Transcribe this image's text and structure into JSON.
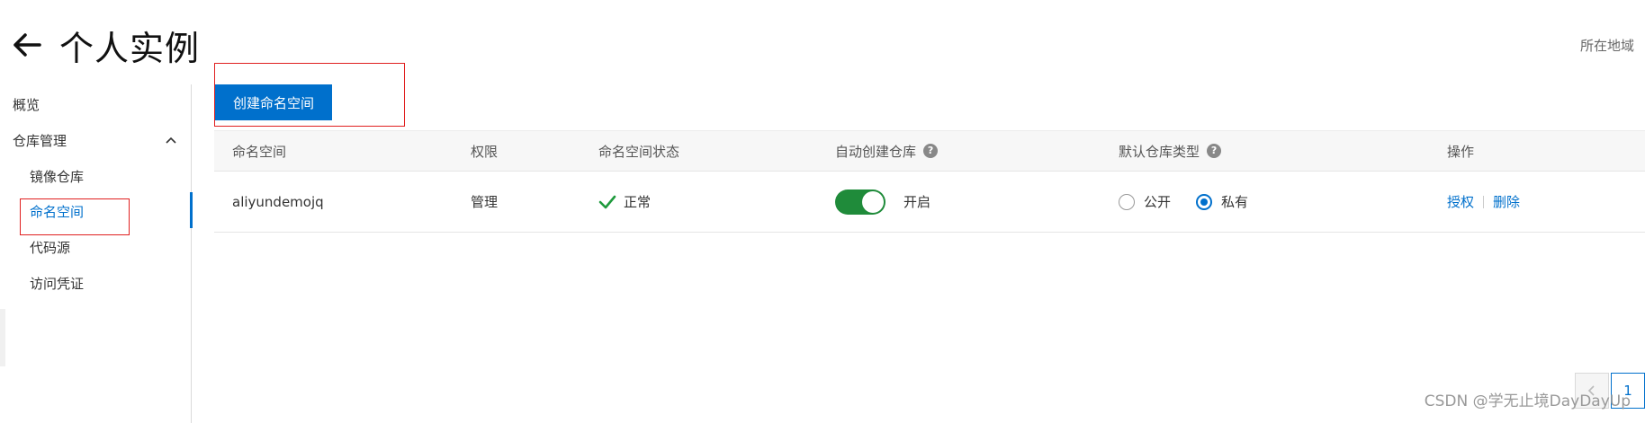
{
  "header": {
    "title": "个人实例",
    "region_label": "所在地域"
  },
  "sidebar": {
    "items": [
      {
        "label": "概览"
      },
      {
        "label": "仓库管理"
      },
      {
        "label": "镜像仓库"
      },
      {
        "label": "命名空间"
      },
      {
        "label": "代码源"
      },
      {
        "label": "访问凭证"
      }
    ],
    "active_item": "命名空间"
  },
  "toolbar": {
    "create_label": "创建命名空间"
  },
  "table": {
    "columns": [
      "命名空间",
      "权限",
      "命名空间状态",
      "自动创建仓库",
      "默认仓库类型",
      "操作"
    ],
    "rows": [
      {
        "namespace": "aliyundemojq",
        "permission": "管理",
        "status": "正常",
        "auto_create": "开启",
        "auto_create_enabled": true,
        "repo_type_options": [
          "公开",
          "私有"
        ],
        "repo_type_selected": "私有",
        "actions": [
          "授权",
          "删除"
        ]
      }
    ]
  },
  "pagination": {
    "current_page": "1"
  },
  "watermark": "CSDN @学无止境DayDayUp",
  "colors": {
    "accent": "#0070cc",
    "toggle_on": "#1f8b3a",
    "status_ok": "#1f9a3d",
    "highlight_box": "#e02020"
  }
}
